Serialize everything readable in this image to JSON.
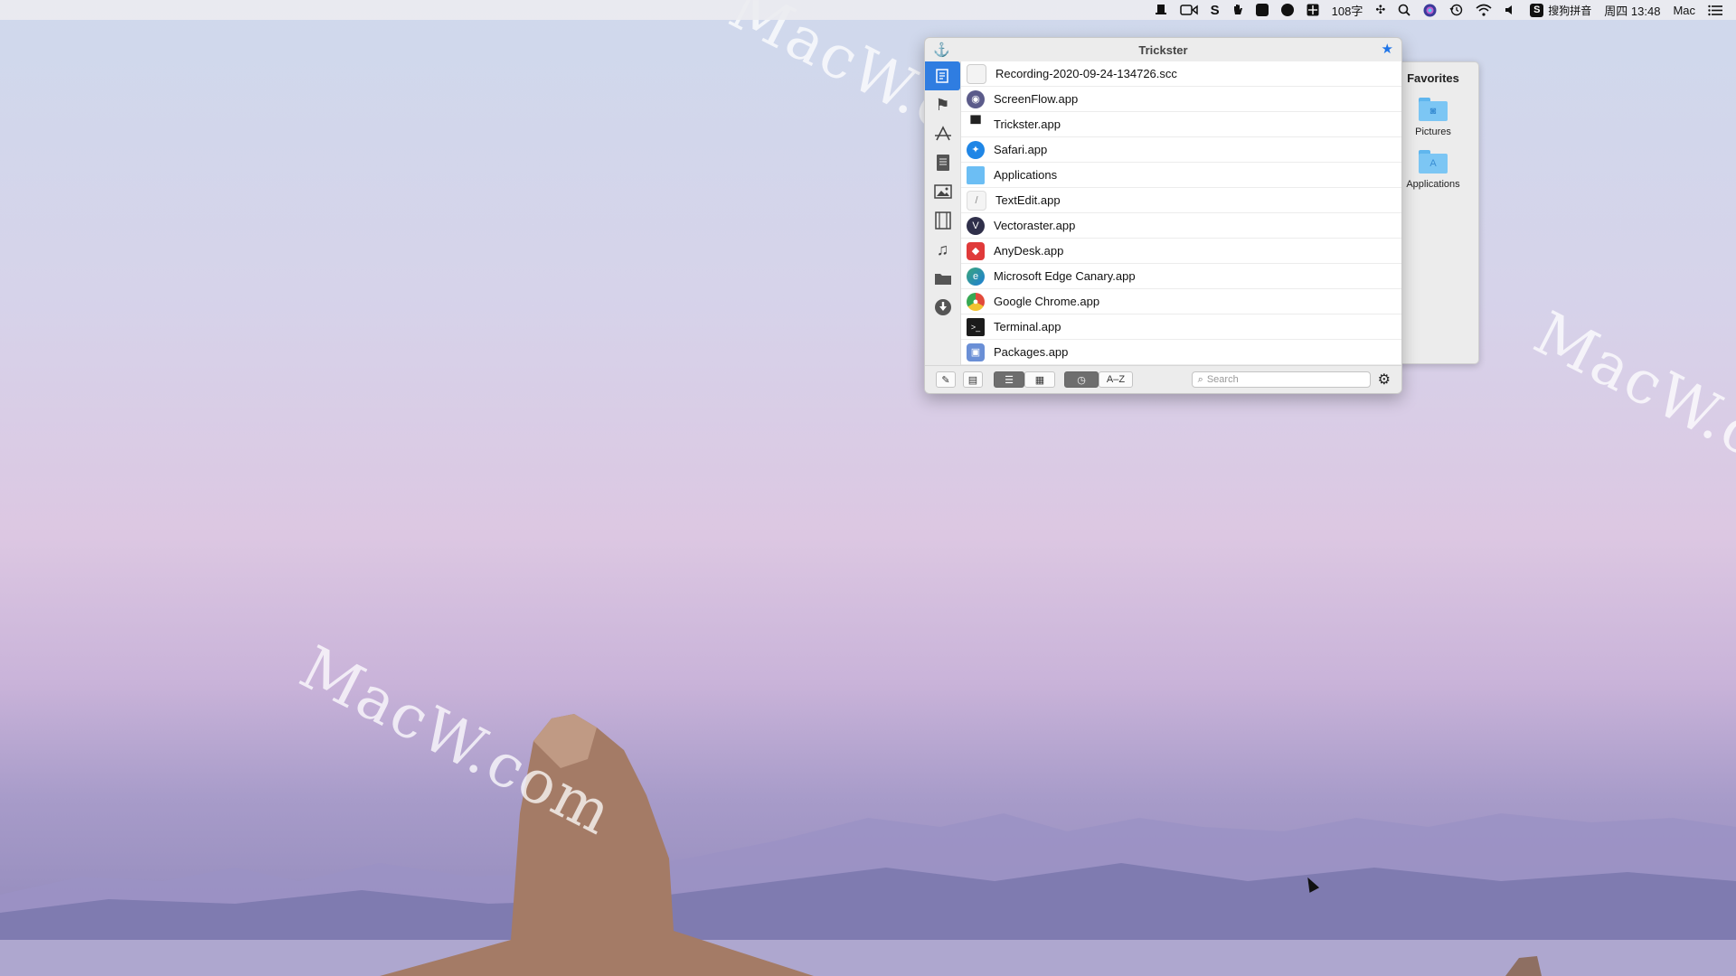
{
  "menubar": {
    "word_count": "108字",
    "input_method": "搜狗拼音",
    "clock": "周四 13:48",
    "user": "Mac",
    "icons": [
      "trickster-icon",
      "facetime-icon",
      "script-icon",
      "hand-icon",
      "app-icon-1",
      "app-icon-2",
      "app-icon-3",
      "move-icon",
      "spotlight-icon",
      "siri-icon",
      "time-machine-icon",
      "wifi-icon",
      "volume-icon",
      "sogou-icon",
      "menu-icon"
    ]
  },
  "watermark": {
    "text": "MacW.com"
  },
  "window": {
    "title": "Trickster",
    "files": [
      {
        "name": "Recording-2020-09-24-134726.scc",
        "icon": "document-icon",
        "color": "#f2f2f2"
      },
      {
        "name": "ScreenFlow.app",
        "icon": "screenflow-icon",
        "color": "#5b5b8a"
      },
      {
        "name": "Trickster.app",
        "icon": "trickster-hat-icon",
        "color": "#2a2a2a"
      },
      {
        "name": "Safari.app",
        "icon": "safari-icon",
        "color": "#1f86e6"
      },
      {
        "name": "Applications",
        "icon": "folder-icon",
        "color": "#6cbef4"
      },
      {
        "name": "TextEdit.app",
        "icon": "textedit-icon",
        "color": "#f4f4f4"
      },
      {
        "name": "Vectoraster.app",
        "icon": "vectoraster-icon",
        "color": "#2f2f4a"
      },
      {
        "name": "AnyDesk.app",
        "icon": "anydesk-icon",
        "color": "#e03a3a"
      },
      {
        "name": "Microsoft Edge Canary.app",
        "icon": "edge-canary-icon",
        "color": "#3aa57a"
      },
      {
        "name": "Google Chrome.app",
        "icon": "chrome-icon",
        "color": "#e9b230"
      },
      {
        "name": "Terminal.app",
        "icon": "terminal-icon",
        "color": "#1b1b1b"
      },
      {
        "name": "Packages.app",
        "icon": "packages-icon",
        "color": "#6a8fd6"
      }
    ],
    "sidebar": [
      "recent-files-icon",
      "flag-icon",
      "app-store-icon",
      "document-icon",
      "image-icon",
      "film-icon",
      "music-icon",
      "folder-icon",
      "download-icon"
    ],
    "toolbar": {
      "sort_az": "A–Z",
      "search_placeholder": "Search"
    }
  },
  "favorites": {
    "title": "Favorites",
    "items": [
      {
        "label": "Pictures",
        "icon": "pictures-folder-icon"
      },
      {
        "label": "Applications",
        "icon": "applications-folder-icon"
      }
    ]
  }
}
